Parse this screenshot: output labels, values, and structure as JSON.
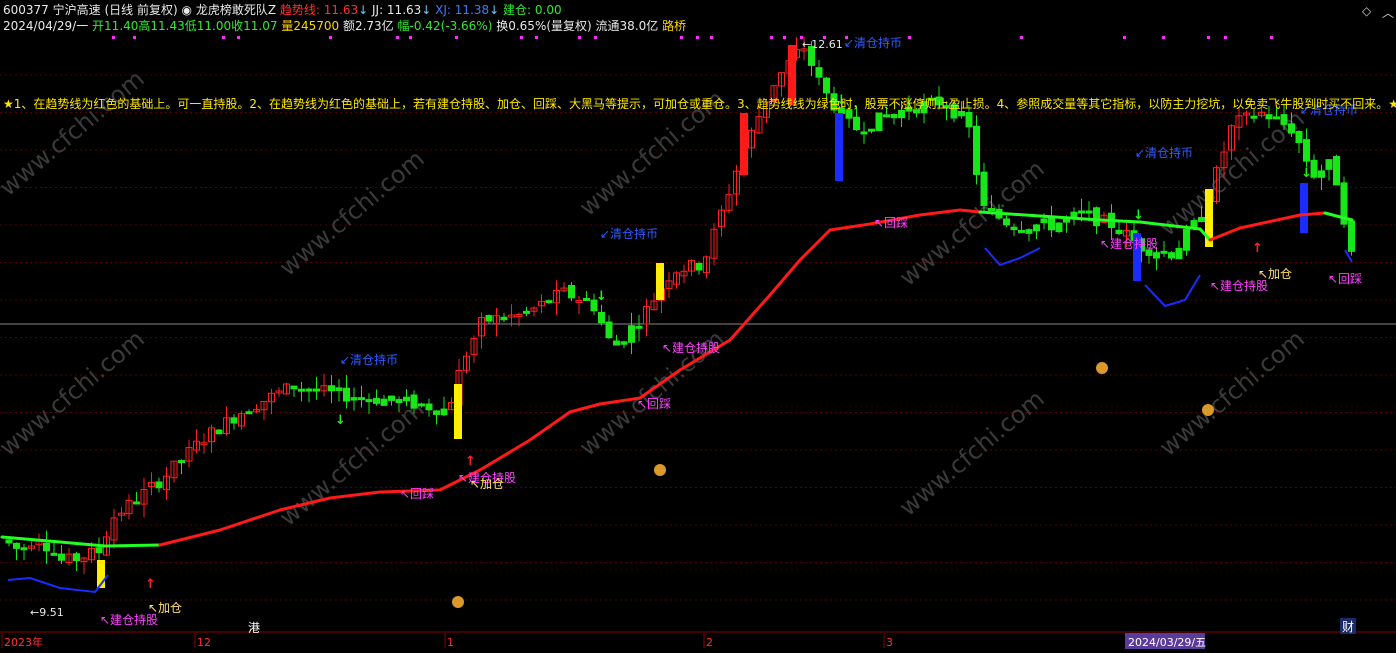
{
  "header": {
    "code": "600377",
    "name": "宁沪高速",
    "period": "(日线 前复权)",
    "indicator_name": "龙虎榜敢死队Z",
    "trend_label": "趋势线: 11.63",
    "jj_label": "JJ: 11.63",
    "xj_label": "XJ: 11.38",
    "jc_label": "建仓: 0.00",
    "date": "2024/04/29/一",
    "open": "开11.40",
    "high": "高11.43",
    "low": "低11.00",
    "close": "收11.07",
    "volume": "量245700",
    "amount": "额2.73亿",
    "change": "幅-0.42(-3.66%)",
    "turnover": "换0.65%(量复权)",
    "float_cap": "流通38.0亿",
    "concept": "路桥"
  },
  "colors": {
    "up": "#ff2020",
    "down": "#19e619",
    "trend_up": "#ff1a1a",
    "trend_down": "#22ff22",
    "support": "#1a2cff",
    "signal_bar": "#ffee00",
    "grid": "#5a0000"
  },
  "annotation_text": "★1、在趋势线为红色的基础上。可一直持股。2、在趋势线为红色的基础上，若有建仓持股、加仓、回踩、大黑马等提示，可加仓或重仓。3、趋势线线为绿色时，股票不涨停则止盈止损。4、参照成交量等其它指标，以防主力挖坑，以免卖飞牛股到时买不回来。★",
  "watermark": "www.cfchi.com",
  "price_labels": {
    "high": "12.61",
    "low": "9.51"
  },
  "signals": [
    {
      "type": "qing",
      "text": "↙清仓持币"
    },
    {
      "type": "jian",
      "text": "↖建仓持股"
    },
    {
      "type": "jia",
      "text": "↖加仓"
    },
    {
      "type": "hui",
      "text": "↖回踩"
    }
  ],
  "time_axis": {
    "labels": [
      "2023年",
      "12",
      "1",
      "2",
      "3"
    ],
    "cursor_date": "2024/03/29/五",
    "hk_marker": "港",
    "cai_marker": "财"
  },
  "chart_data": {
    "type": "candlestick",
    "note_markers": [
      "清仓持币",
      "建仓持股",
      "加仓",
      "回踩"
    ],
    "ohlc": []
  }
}
